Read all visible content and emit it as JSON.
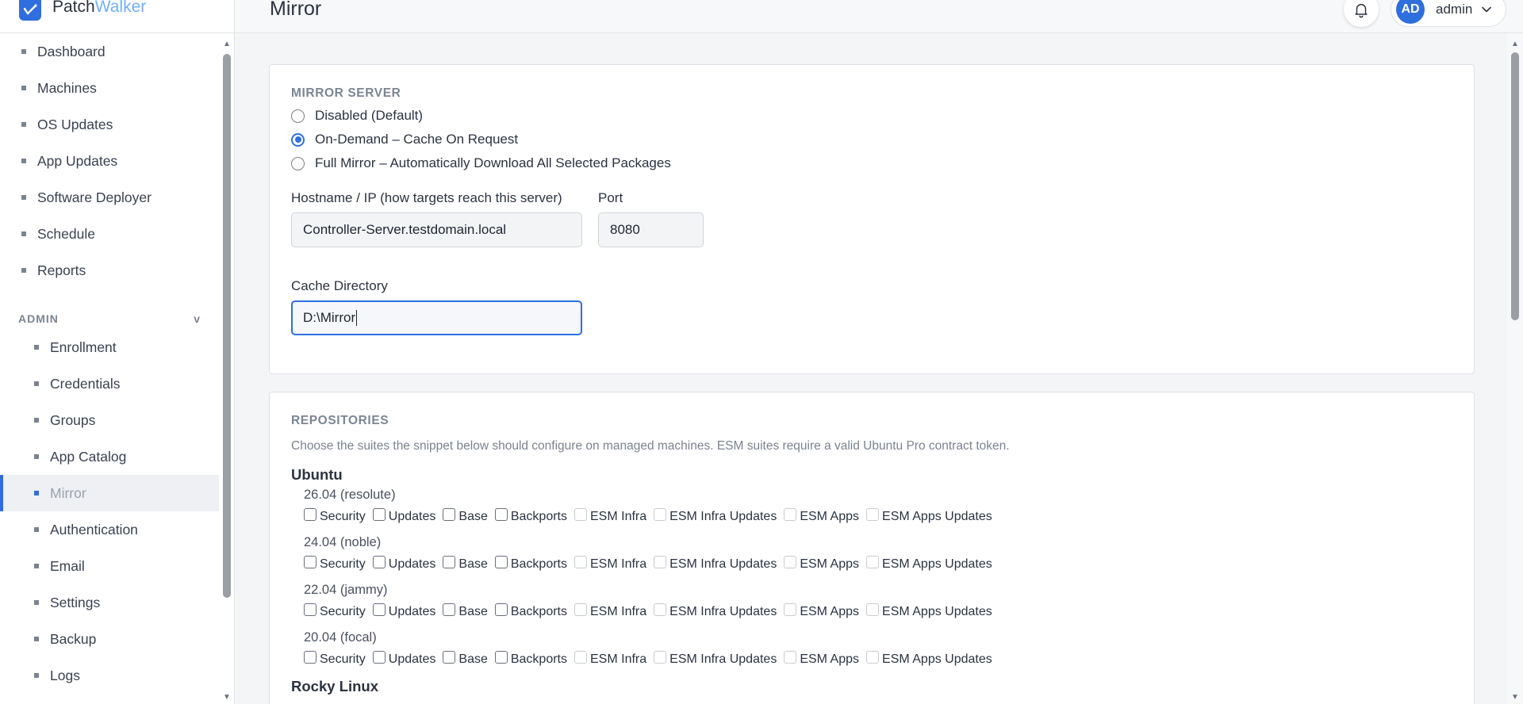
{
  "brand": {
    "name_part1": "Patch",
    "name_part2": "Walker",
    "logo_icon": "check-chart-icon",
    "accent_color": "#76aef3"
  },
  "header": {
    "title": "Mirror",
    "user_initials": "AD",
    "user_name": "admin"
  },
  "sidebar": {
    "items": [
      {
        "label": "Dashboard"
      },
      {
        "label": "Machines"
      },
      {
        "label": "OS Updates"
      },
      {
        "label": "App Updates"
      },
      {
        "label": "Software Deployer"
      },
      {
        "label": "Schedule"
      },
      {
        "label": "Reports"
      }
    ],
    "admin_section": {
      "label": "ADMIN",
      "toggle": "v"
    },
    "admin_items": [
      {
        "label": "Enrollment"
      },
      {
        "label": "Credentials"
      },
      {
        "label": "Groups"
      },
      {
        "label": "App Catalog"
      },
      {
        "label": "Mirror",
        "active": true
      },
      {
        "label": "Authentication"
      },
      {
        "label": "Email"
      },
      {
        "label": "Settings"
      },
      {
        "label": "Backup"
      },
      {
        "label": "Logs"
      }
    ]
  },
  "mirror_server": {
    "title": "MIRROR SERVER",
    "mode_options": [
      {
        "label": "Disabled (Default)",
        "checked": false
      },
      {
        "label": "On-Demand – Cache On Request",
        "checked": true
      },
      {
        "label": "Full Mirror – Automatically Download All Selected Packages",
        "checked": false
      }
    ],
    "hostname_label": "Hostname / IP (how targets reach this server)",
    "hostname_value": "Controller-Server.testdomain.local",
    "port_label": "Port",
    "port_value": "8080",
    "cache_dir_label": "Cache Directory",
    "cache_dir_value": "D:\\Mirror"
  },
  "repositories": {
    "title": "REPOSITORIES",
    "help": "Choose the suites the snippet below should configure on managed machines. ESM suites require a valid Ubuntu Pro contract token.",
    "distros": [
      {
        "name": "Ubuntu",
        "versions": [
          {
            "name": "26.04 (resolute)"
          },
          {
            "name": "24.04 (noble)"
          },
          {
            "name": "22.04 (jammy)"
          },
          {
            "name": "20.04 (focal)"
          }
        ]
      },
      {
        "name": "Rocky Linux"
      }
    ],
    "suites": [
      {
        "label": "Security",
        "enabled": true
      },
      {
        "label": "Updates",
        "enabled": true
      },
      {
        "label": "Base",
        "enabled": true
      },
      {
        "label": "Backports",
        "enabled": true
      },
      {
        "label": "ESM Infra",
        "enabled": false
      },
      {
        "label": "ESM Infra Updates",
        "enabled": false
      },
      {
        "label": "ESM Apps",
        "enabled": false
      },
      {
        "label": "ESM Apps Updates",
        "enabled": false
      }
    ]
  }
}
